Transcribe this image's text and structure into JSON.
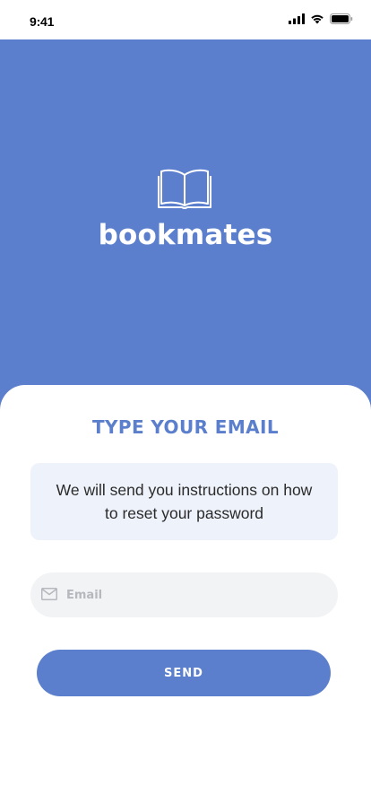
{
  "status_bar": {
    "time": "9:41",
    "icons": [
      "cellular-signal-icon",
      "wifi-icon",
      "battery-icon"
    ]
  },
  "hero": {
    "logo_icon": "open-book-icon",
    "brand_name": "bookmates",
    "background_color": "#5b7fcc"
  },
  "reset": {
    "title": "TYPE YOUR EMAIL",
    "info_text": "We will send you instructions on how to reset your password",
    "email_field": {
      "icon": "mail-icon",
      "placeholder": "Email",
      "value": ""
    },
    "send_label": "SEND"
  },
  "colors": {
    "accent": "#5b7fcc",
    "info_box": "#eef2fa",
    "field": "#f2f3f5"
  }
}
